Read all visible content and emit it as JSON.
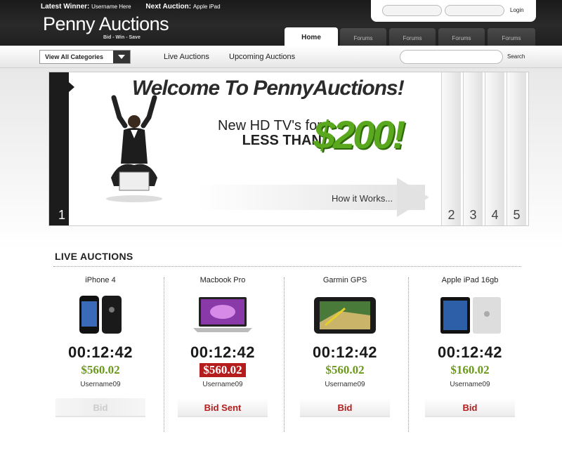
{
  "header": {
    "latest_winner_label": "Latest Winner:",
    "latest_winner_value": "Username Here",
    "next_auction_label": "Next Auction:",
    "next_auction_value": "Apple iPad",
    "logo": "Penny Auctions",
    "tagline": "Bid - Win - Save",
    "login_label": "Login",
    "tabs": [
      "Home",
      "Forums",
      "Forums",
      "Forums",
      "Forums"
    ]
  },
  "nav": {
    "category_select": "View All Categories",
    "links": [
      "Live Auctions",
      "Upcoming Auctions"
    ],
    "search_label": "Search"
  },
  "hero": {
    "headline": "Welcome To PennyAuctions!",
    "promo_line1": "New HD TV's for",
    "promo_line2": "LESS THAN",
    "promo_price": "$200!",
    "cta": "How it Works...",
    "slides": [
      "1",
      "2",
      "3",
      "4",
      "5"
    ]
  },
  "section": {
    "title": "LIVE AUCTIONS"
  },
  "auctions": [
    {
      "name": "iPhone 4",
      "timer": "00:12:42",
      "price": "$560.02",
      "user": "Username09",
      "bid_label": "Bid",
      "state": "disabled",
      "icon": "iphone-icon"
    },
    {
      "name": "Macbook Pro",
      "timer": "00:12:42",
      "price": "$560.02",
      "user": "Username09",
      "bid_label": "Bid Sent",
      "state": "sent",
      "icon": "laptop-icon"
    },
    {
      "name": "Garmin GPS",
      "timer": "00:12:42",
      "price": "$560.02",
      "user": "Username09",
      "bid_label": "Bid",
      "state": "active",
      "icon": "gps-icon"
    },
    {
      "name": "Apple iPad 16gb",
      "timer": "00:12:42",
      "price": "$160.02",
      "user": "Username09",
      "bid_label": "Bid",
      "state": "active",
      "icon": "ipad-icon"
    }
  ],
  "colors": {
    "accent_green": "#6b9a1a",
    "bid_red": "#b51c1c",
    "header_dark": "#1f1f1f"
  }
}
